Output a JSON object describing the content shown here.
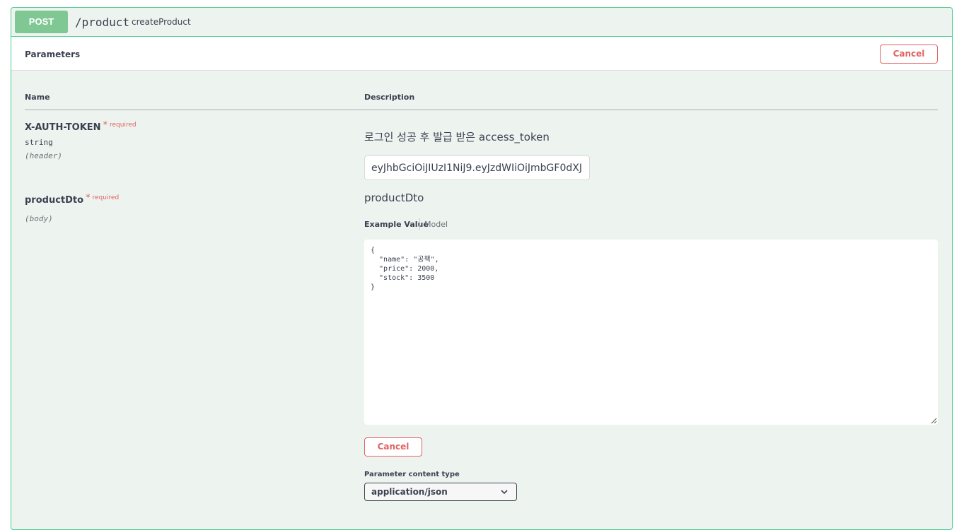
{
  "summary": {
    "method": "POST",
    "path": "/product",
    "operation_id": "createProduct",
    "accent_color": "#49cc90"
  },
  "parameters_section": {
    "title": "Parameters",
    "cancel_label": "Cancel"
  },
  "columns": {
    "name": "Name",
    "description": "Description"
  },
  "params": [
    {
      "name": "X-AUTH-TOKEN",
      "required_mark": "*",
      "required_label": "required",
      "type": "string",
      "in": "(header)",
      "description": "로그인 성공 후 발급 받은 access_token",
      "value": "eyJhbGciOiJIUzI1NiJ9.eyJzdWIiOiJmbGF0dXJ"
    },
    {
      "name": "productDto",
      "required_mark": "*",
      "required_label": "required",
      "in": "(body)",
      "description": "productDto"
    }
  ],
  "body": {
    "tab_example": "Example Value",
    "tab_model": "Model",
    "editor_value": "{\n  \"name\": \"공책\",\n  \"price\": 2000,\n  \"stock\": 3500\n}",
    "cancel_label": "Cancel"
  },
  "content_type": {
    "label": "Parameter content type",
    "selected": "application/json"
  }
}
